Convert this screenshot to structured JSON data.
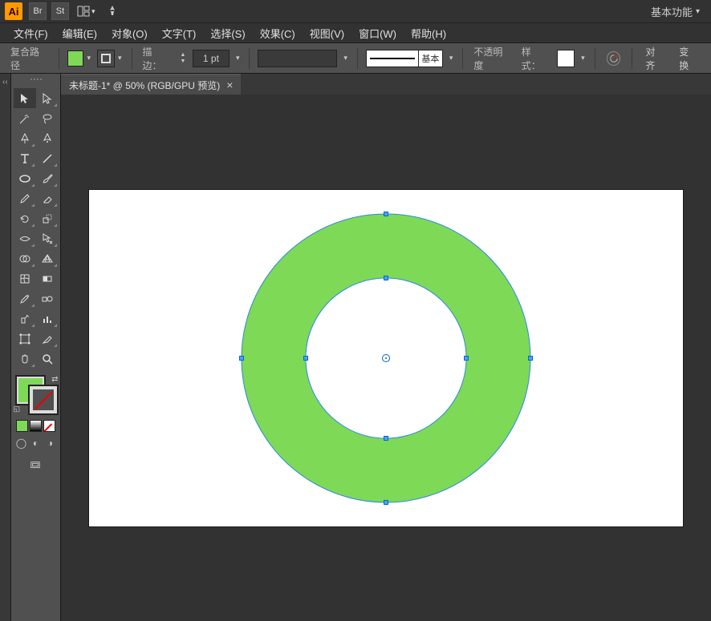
{
  "app": {
    "logo": "Ai"
  },
  "topIcons": {
    "br": "Br",
    "st": "St"
  },
  "workspace": {
    "label": "基本功能"
  },
  "menu": {
    "file": "文件(F)",
    "edit": "编辑(E)",
    "object": "对象(O)",
    "type": "文字(T)",
    "select": "选择(S)",
    "effect": "效果(C)",
    "view": "视图(V)",
    "window": "窗口(W)",
    "help": "帮助(H)"
  },
  "control": {
    "selection_label": "复合路径",
    "stroke_label": "描边：",
    "stroke_value": "1 pt",
    "brush_label": "基本",
    "opacity_label": "不透明度",
    "style_label": "样式：",
    "align_label": "对齐",
    "transform_label": "变换"
  },
  "doc": {
    "tab_title": "未标题-1* @ 50% (RGB/GPU 预览)"
  },
  "colors": {
    "fill": "#7ed957",
    "selection": "#0066cc"
  }
}
